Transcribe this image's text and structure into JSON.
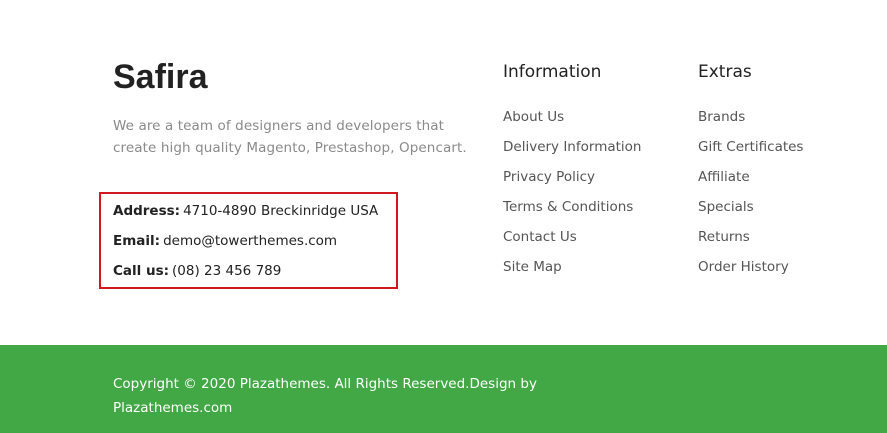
{
  "brand": {
    "logo_text": "Safira"
  },
  "about_text": "We are a team of designers and developers that create high quality Magento, Prestashop, Opencart.",
  "contact": {
    "address_label": "Address:",
    "address_value": "4710-4890 Breckinridge USA",
    "email_label": "Email:",
    "email_value": "demo@towerthemes.com",
    "phone_label": "Call us:",
    "phone_value": "(08) 23 456 789"
  },
  "information": {
    "title": "Information",
    "links": [
      "About Us",
      "Delivery Information",
      "Privacy Policy",
      "Terms & Conditions",
      "Contact Us",
      "Site Map"
    ]
  },
  "extras": {
    "title": "Extras",
    "links": [
      "Brands",
      "Gift Certificates",
      "Affiliate",
      "Specials",
      "Returns",
      "Order History"
    ]
  },
  "copyright": "Copyright © 2020 Plazathemes. All Rights Reserved.Design by Plazathemes.com",
  "colors": {
    "footer_bottom": "#41a845",
    "highlight_box": "#d0181e",
    "text_dark": "#222222",
    "text_muted": "#8a8a8a"
  }
}
